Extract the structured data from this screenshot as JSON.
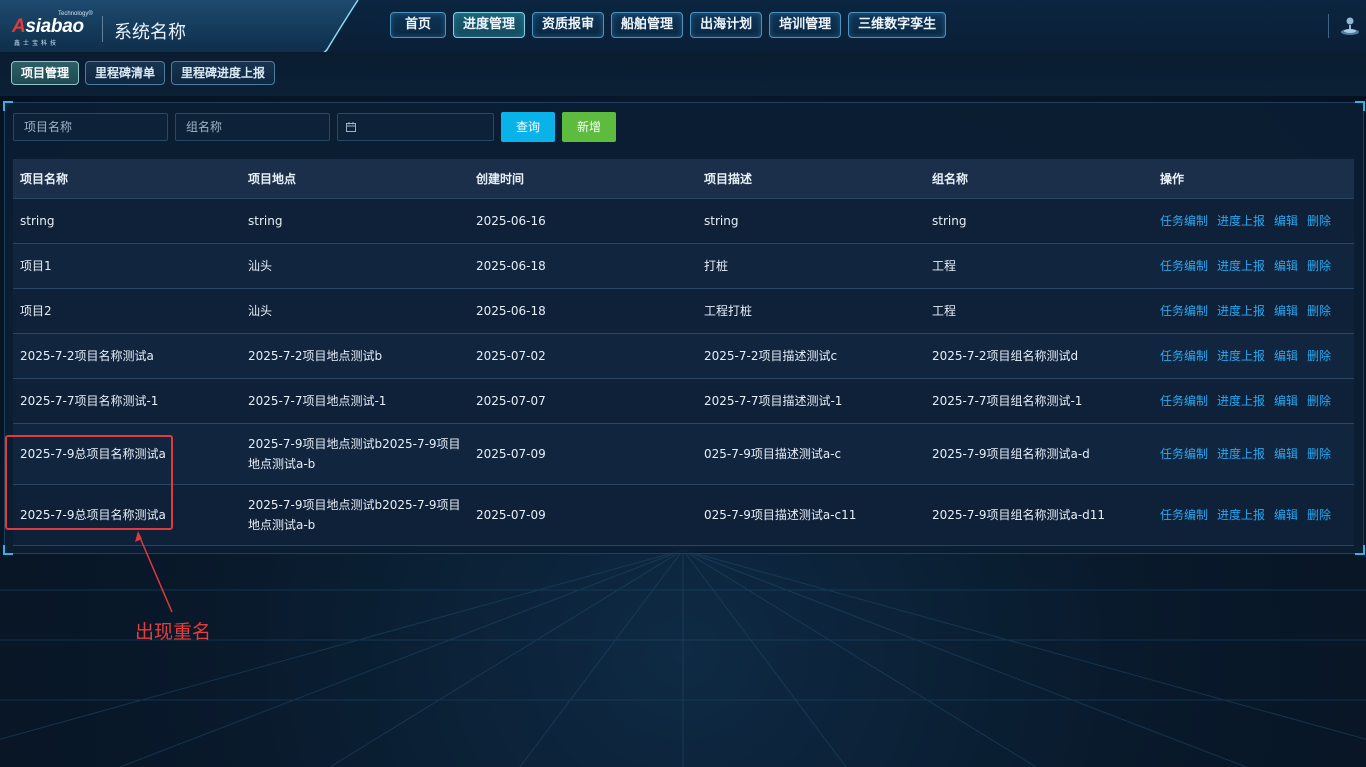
{
  "brand": {
    "logo_text": "Asiabao",
    "logo_tag": "Technology®",
    "logo_cn": "鑫士宝科技",
    "system_name": "系统名称"
  },
  "nav": [
    {
      "label": "首页",
      "active": false
    },
    {
      "label": "进度管理",
      "active": true
    },
    {
      "label": "资质报审",
      "active": false
    },
    {
      "label": "船舶管理",
      "active": false
    },
    {
      "label": "出海计划",
      "active": false
    },
    {
      "label": "培训管理",
      "active": false
    },
    {
      "label": "三维数字孪生",
      "active": false
    }
  ],
  "subtabs": [
    {
      "label": "项目管理",
      "active": true
    },
    {
      "label": "里程碑清单",
      "active": false
    },
    {
      "label": "里程碑进度上报",
      "active": false
    }
  ],
  "filters": {
    "project_name_placeholder": "项目名称",
    "group_name_placeholder": "组名称",
    "query_label": "查询",
    "add_label": "新增"
  },
  "table": {
    "columns": [
      "项目名称",
      "项目地点",
      "创建时间",
      "项目描述",
      "组名称",
      "操作"
    ],
    "actions": [
      "任务编制",
      "进度上报",
      "编辑",
      "删除"
    ],
    "rows": [
      [
        "string",
        "string",
        "2025-06-16",
        "string",
        "string"
      ],
      [
        "项目1",
        "汕头",
        "2025-06-18",
        "打桩",
        "工程"
      ],
      [
        "项目2",
        "汕头",
        "2025-06-18",
        "工程打桩",
        "工程"
      ],
      [
        "2025-7-2项目名称测试a",
        "2025-7-2项目地点测试b",
        "2025-07-02",
        "2025-7-2项目描述测试c",
        "2025-7-2项目组名称测试d"
      ],
      [
        "2025-7-7项目名称测试-1",
        "2025-7-7项目地点测试-1",
        "2025-07-07",
        "2025-7-7项目描述测试-1",
        "2025-7-7项目组名称测试-1"
      ],
      [
        "2025-7-9总项目名称测试a",
        "2025-7-9项目地点测试b2025-7-9项目地点测试a-b",
        "2025-07-09",
        "025-7-9项目描述测试a-c",
        "2025-7-9项目组名称测试a-d"
      ],
      [
        "2025-7-9总项目名称测试a",
        "2025-7-9项目地点测试b2025-7-9项目地点测试a-b",
        "2025-07-09",
        "025-7-9项目描述测试a-c11",
        "2025-7-9项目组名称测试a-d11"
      ]
    ]
  },
  "annotation": {
    "text": "出现重名",
    "color": "#e63c3c"
  },
  "colors": {
    "accent": "#0ab2ea",
    "add": "#5dbb3e",
    "link": "#29a8f0"
  }
}
